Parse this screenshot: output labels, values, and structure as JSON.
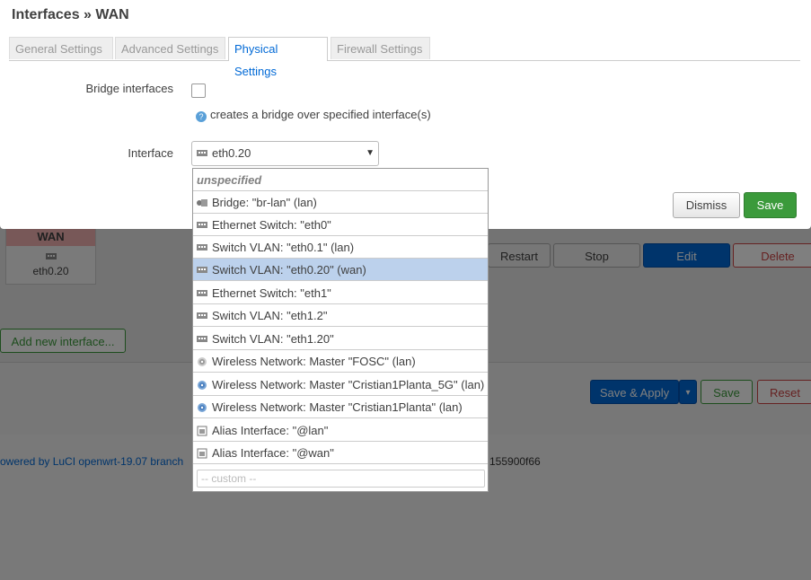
{
  "modal": {
    "title": "Interfaces » WAN",
    "tabs": [
      {
        "label": "General Settings"
      },
      {
        "label": "Advanced Settings"
      },
      {
        "label": "Physical Settings"
      },
      {
        "label": "Firewall Settings"
      }
    ],
    "bridge_label": "Bridge interfaces",
    "bridge_hint": "creates a bridge over specified interface(s)",
    "interface_label": "Interface",
    "interface_value": "eth0.20",
    "dismiss_label": "Dismiss",
    "save_label": "Save"
  },
  "dropdown": {
    "unspecified": "unspecified",
    "options": [
      {
        "label": "Bridge: \"br-lan\" (lan)",
        "icon": "bridge-icon"
      },
      {
        "label": "Ethernet Switch: \"eth0\"",
        "icon": "ethernet-icon"
      },
      {
        "label": "Switch VLAN: \"eth0.1\" (lan)",
        "icon": "vlan-icon"
      },
      {
        "label": "Switch VLAN: \"eth0.20\" (wan)",
        "icon": "vlan-icon"
      },
      {
        "label": "Ethernet Switch: \"eth1\"",
        "icon": "ethernet-icon"
      },
      {
        "label": "Switch VLAN: \"eth1.2\"",
        "icon": "vlan-icon"
      },
      {
        "label": "Switch VLAN: \"eth1.20\"",
        "icon": "vlan-icon"
      },
      {
        "label": "Wireless Network: Master \"FOSC\" (lan)",
        "icon": "wireless-icon"
      },
      {
        "label": "Wireless Network: Master \"Cristian1Planta_5G\" (lan)",
        "icon": "wireless-icon"
      },
      {
        "label": "Wireless Network: Master \"Cristian1Planta\" (lan)",
        "icon": "wireless-icon"
      },
      {
        "label": "Alias Interface: \"@lan\"",
        "icon": "alias-icon"
      },
      {
        "label": "Alias Interface: \"@wan\"",
        "icon": "alias-icon"
      }
    ],
    "custom_placeholder": "-- custom --"
  },
  "background": {
    "wan_card_title": "WAN",
    "wan_card_device": "eth0.20",
    "restart_label": "Restart",
    "stop_label": "Stop",
    "edit_label": "Edit",
    "delete_label": "Delete",
    "add_interface_label": "Add new interface...",
    "save_apply_label": "Save & Apply",
    "save_label": "Save",
    "reset_label": "Reset",
    "powered_by": "owered by LuCI openwrt-19.07 branch",
    "hash_fragment": "155900f66"
  },
  "colors": {
    "accent": "#0069d6",
    "save_green": "#3b9a3b",
    "selected_option": "#bcd1ec",
    "wan_header": "#f0b0b0"
  }
}
